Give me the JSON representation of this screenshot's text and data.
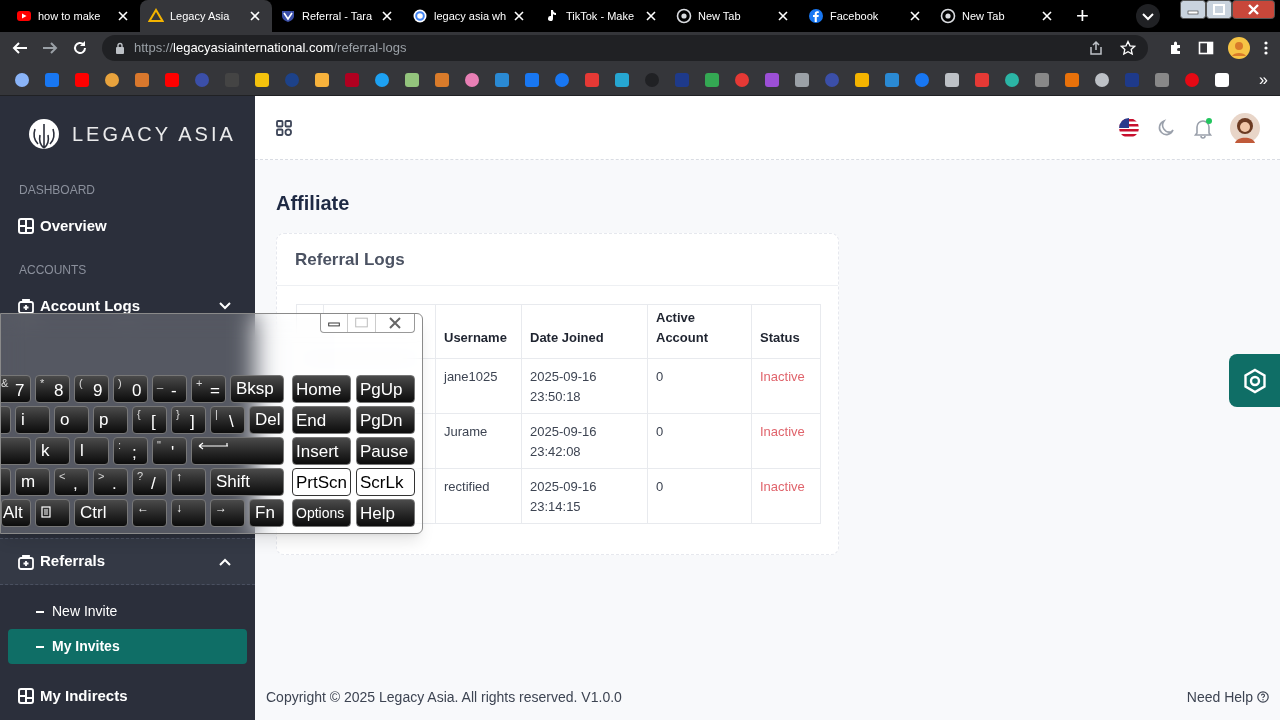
{
  "browser": {
    "tabs": [
      {
        "title": "how to make",
        "kind": "play",
        "selected": false
      },
      {
        "title": "Legacy Asia",
        "kind": "triangle",
        "selected": true
      },
      {
        "title": "Referral - Tara",
        "kind": "shield",
        "selected": false
      },
      {
        "title": "legacy asia wh",
        "kind": "ring",
        "selected": false
      },
      {
        "title": "TikTok - Make",
        "kind": "note",
        "selected": false
      },
      {
        "title": "New Tab",
        "kind": "globe",
        "selected": false
      },
      {
        "title": "Facebook",
        "kind": "disc",
        "selected": false
      },
      {
        "title": "New Tab",
        "kind": "globe",
        "selected": false
      }
    ],
    "new_tab": "+",
    "url": {
      "scheme": "https://",
      "host": "legacyasiainternational.com",
      "path": "/referral-logs"
    },
    "bookmarks_more": "»"
  },
  "sidebar": {
    "brand": "LEGACY ASIA",
    "sections": [
      {
        "heading": "DASHBOARD",
        "items": [
          {
            "label": "Overview",
            "kind": "dashboard"
          }
        ]
      },
      {
        "heading": "ACCOUNTS",
        "items": [
          {
            "label": "Account Logs",
            "kind": "case",
            "expanded": false
          }
        ]
      }
    ],
    "lower_items": [
      {
        "label": "Referrals",
        "kind": "case",
        "expanded": true,
        "children": [
          {
            "label": "New Invite",
            "selected": false
          },
          {
            "label": "My Invites",
            "selected": true
          }
        ]
      },
      {
        "label": "My Indirects",
        "kind": "dashboard"
      }
    ]
  },
  "header": {
    "notification_dot": true
  },
  "page_title": "Affiliate",
  "card": {
    "title": "Referral Logs",
    "table": {
      "columns": [
        {
          "label": "Username"
        },
        {
          "label": "Date Joined"
        },
        {
          "label": "Active Account"
        },
        {
          "label": "Status"
        }
      ],
      "rows": [
        {
          "username": "jane1025",
          "date_joined": "2025-09-16 23:50:18",
          "active_account": "0",
          "status": "Inactive",
          "kind": "inactive"
        },
        {
          "username": "Jurame",
          "date_joined": "2025-09-16 23:42:08",
          "active_account": "0",
          "status": "Inactive",
          "kind": "inactive"
        },
        {
          "username": "rectified",
          "date_joined": "2025-09-16 23:14:15",
          "active_account": "0",
          "status": "Inactive",
          "kind": "inactive"
        }
      ]
    }
  },
  "footer": {
    "copyright": "Copyright © 2025 Legacy Asia. All rights reserved. V1.0.0",
    "help": "Need Help"
  },
  "keyboard": {
    "rows": [
      {
        "keys": [
          {
            "shift": "&",
            "label": "7",
            "kind": "key"
          },
          {
            "shift": "*",
            "label": "8",
            "kind": "key"
          },
          {
            "shift": "(",
            "label": "9",
            "kind": "key"
          },
          {
            "shift": ")",
            "label": "0",
            "kind": "key"
          },
          {
            "shift": "_",
            "label": "-",
            "kind": "key"
          },
          {
            "shift": "+",
            "label": "=",
            "kind": "key"
          },
          {
            "label": "Bksp",
            "kind": "wide"
          }
        ]
      },
      {
        "keys": [
          {
            "kind": "blank"
          },
          {
            "label": "i",
            "kind": "key"
          },
          {
            "label": "o",
            "kind": "key"
          },
          {
            "label": "p",
            "kind": "key"
          },
          {
            "shift": "{",
            "label": "[",
            "kind": "key"
          },
          {
            "shift": "}",
            "label": "]",
            "kind": "key"
          },
          {
            "shift": "|",
            "label": "\\",
            "kind": "key"
          },
          {
            "label": "Del",
            "kind": "key"
          }
        ]
      },
      {
        "keys": [
          {
            "kind": "blank"
          },
          {
            "label": "k",
            "kind": "key"
          },
          {
            "label": "l",
            "kind": "key"
          },
          {
            "shift": ":",
            "label": ";",
            "kind": "key"
          },
          {
            "shift": "\"",
            "label": "'",
            "kind": "key"
          },
          {
            "kind": "enter"
          }
        ]
      },
      {
        "keys": [
          {
            "kind": "blank"
          },
          {
            "label": "m",
            "kind": "key"
          },
          {
            "shift": "<",
            "label": ",",
            "kind": "key"
          },
          {
            "shift": ">",
            "label": ".",
            "kind": "key"
          },
          {
            "shift": "?",
            "label": "/",
            "kind": "key"
          },
          {
            "label": "↑",
            "kind": "arrow"
          },
          {
            "label": "Shift",
            "kind": "shift"
          }
        ]
      },
      {
        "keys": [
          {
            "label": "Alt",
            "kind": "alt"
          },
          {
            "kind": "menu"
          },
          {
            "label": "Ctrl",
            "kind": "ctrl"
          },
          {
            "label": "←",
            "kind": "arrow"
          },
          {
            "label": "↓",
            "kind": "arrow"
          },
          {
            "label": "→",
            "kind": "arrow"
          },
          {
            "label": "Fn",
            "kind": "key"
          }
        ]
      }
    ],
    "side_rows": [
      [
        {
          "label": "Home",
          "lit": false
        },
        {
          "label": "PgUp",
          "lit": false
        }
      ],
      [
        {
          "label": "End",
          "lit": false
        },
        {
          "label": "PgDn",
          "lit": false
        }
      ],
      [
        {
          "label": "Insert",
          "lit": false
        },
        {
          "label": "Pause",
          "lit": false
        }
      ],
      [
        {
          "label": "PrtScn",
          "lit": true
        },
        {
          "label": "ScrLk",
          "lit": true
        }
      ],
      [
        {
          "label": "Options",
          "lit": false,
          "kind": "small"
        },
        {
          "label": "Help",
          "lit": false
        }
      ]
    ]
  }
}
